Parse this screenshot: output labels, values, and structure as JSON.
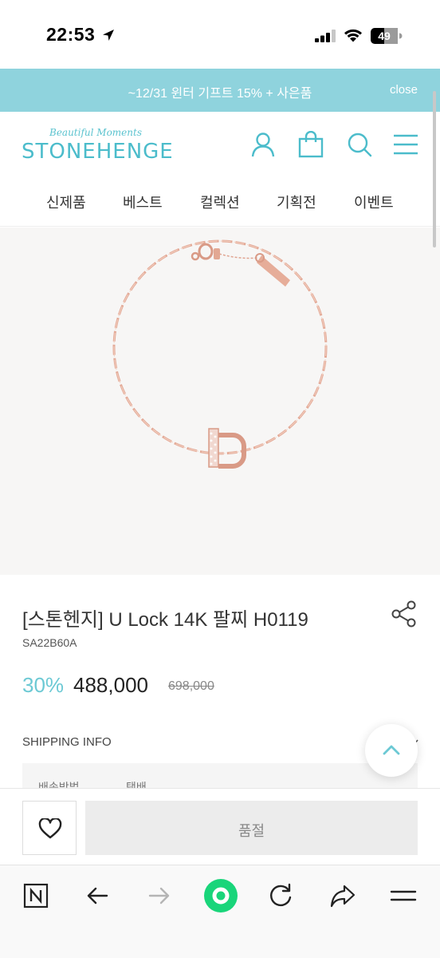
{
  "status_bar": {
    "time": "22:53",
    "battery": "49"
  },
  "promo": {
    "text": "~12/31 윈터 기프트 15% + 사은품",
    "close_label": "close"
  },
  "brand": {
    "tagline": "Beautiful Moments",
    "name": "STONEHENGE",
    "accent_color": "#4bbccb",
    "promo_color": "#8fd3dd"
  },
  "header_icons": [
    "user-icon",
    "shopping-bag-icon",
    "search-icon",
    "menu-icon"
  ],
  "nav": {
    "items": [
      {
        "label": "신제품"
      },
      {
        "label": "베스트"
      },
      {
        "label": "컬렉션"
      },
      {
        "label": "기획전"
      },
      {
        "label": "이벤트"
      }
    ]
  },
  "product": {
    "title": "[스톤헨지] U Lock 14K 팔찌 H0119",
    "code": "SA22B60A",
    "discount": "30%",
    "price": "488,000",
    "original_price": "698,000"
  },
  "shipping": {
    "heading": "SHIPPING INFO",
    "row_label": "배송방법",
    "row_value": "택배"
  },
  "actions": {
    "soldout_label": "품절"
  },
  "browser_toolbar": [
    "naver-n-icon",
    "back-arrow-icon",
    "forward-arrow-icon",
    "green-home-icon",
    "refresh-icon",
    "share-arrow-icon",
    "menu-icon"
  ]
}
